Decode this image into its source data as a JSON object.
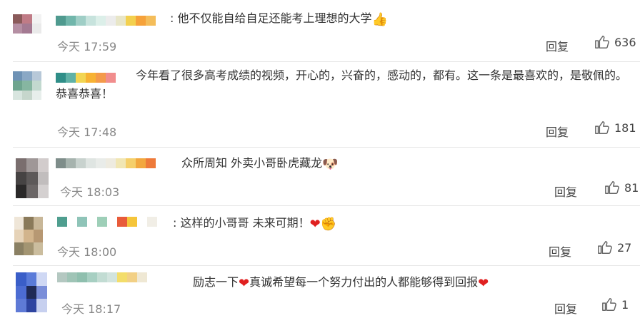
{
  "comments": [
    {
      "text_before": "他不仅能自给自足还能考上理想的大学",
      "emoji_after": "👍",
      "text_middle": "",
      "emoji_middle": "",
      "time": "今天 17:59",
      "reply": "回复",
      "likes": "636",
      "avatar_colors": [
        "#8a5a5a",
        "#c07b86",
        "#f2f2f2",
        "#b58fa3",
        "#a47a92",
        "#eaeaea",
        "#ffffff",
        "#ffffff",
        "#ffffff"
      ],
      "name_colors": [
        "#4f9a8f",
        "#71b6ab",
        "#9fcec6",
        "#c7e3dd",
        "#dcefe9",
        "#ececec",
        "#e8e6c8",
        "#f3d04e",
        "#f6a23a",
        "#f4bd5a"
      ]
    },
    {
      "text_before": "今年看了很多高考成绩的视频，开心的，兴奋的，感动的，都有。这一条是最喜欢的，是敬佩的。恭喜恭喜！",
      "emoji_after": "",
      "time": "今天 17:48",
      "reply": "回复",
      "likes": "181",
      "avatar_colors": [
        "#6e92b5",
        "#8aa8c5",
        "#b7c8d8",
        "#6fa58f",
        "#86b6a1",
        "#c2d9cf",
        "#d8e5df",
        "#c6d6cc",
        "#e7eeeb"
      ],
      "name_colors": [
        "#2f8e88",
        "#5fb1a6",
        "#f2d552",
        "#f7b233",
        "#f49a4a",
        "#f18d8d"
      ]
    },
    {
      "text_before": "众所周知 外卖小哥卧虎藏龙",
      "emoji_after": "🐶",
      "time": "今天 18:03",
      "reply": "回复",
      "likes": "81",
      "avatar_colors": [
        "#7a6e6e",
        "#9f9797",
        "#d2cccc",
        "#464343",
        "#5d5959",
        "#c1bdbd",
        "#2a2828",
        "#6b6666",
        "#d4d0d0"
      ],
      "name_colors": [
        "#7e8d8a",
        "#a6b3ae",
        "#c8d2ce",
        "#dfe5e2",
        "#e9ece9",
        "#eeebe0",
        "#f1e6b3",
        "#f5cf6a",
        "#f2a73e",
        "#ee7a3a"
      ]
    },
    {
      "text_before": "这样的小哥哥  未来可期！",
      "emoji_after": "❤",
      "emoji_after2": "✊",
      "time": "今天 18:00",
      "reply": "回复",
      "likes": "27",
      "avatar_colors": [
        "#efe6d8",
        "#8a7a5a",
        "#c8b798",
        "#e6d3b8",
        "#d2b48c",
        "#b79873",
        "#8a8063",
        "#a39572",
        "#cbbd9e"
      ],
      "name_colors": [
        "#4f9e8f",
        "#ffffff",
        "#8fc4b8",
        "#ffffff",
        "#9ecfb8",
        "#ffffff",
        "#e85b3a",
        "#f5c53a",
        "#ffffff",
        "#f1eee6"
      ]
    },
    {
      "text_before": "励志一下",
      "emoji_middle": "❤",
      "text_middle": "真诚希望每一个努力付出的人都能够得到回报",
      "emoji_after": "❤",
      "time": "今天 18:17",
      "reply": "回复",
      "likes": "1",
      "avatar_colors": [
        "#3a5ec8",
        "#5a7bd9",
        "#cfd8f4",
        "#4c6cd2",
        "#1f2a56",
        "#7a8ed9",
        "#5e7ad6",
        "#2e44a0",
        "#c7d0ef"
      ],
      "name_colors": [
        "#b4c8c1",
        "#9fc4b6",
        "#8fbfae",
        "#a7cfc2",
        "#c2dcd3",
        "#d2e4de",
        "#f3dd6a",
        "#f2d085",
        "#efe8d4",
        "#ffffff"
      ]
    }
  ]
}
